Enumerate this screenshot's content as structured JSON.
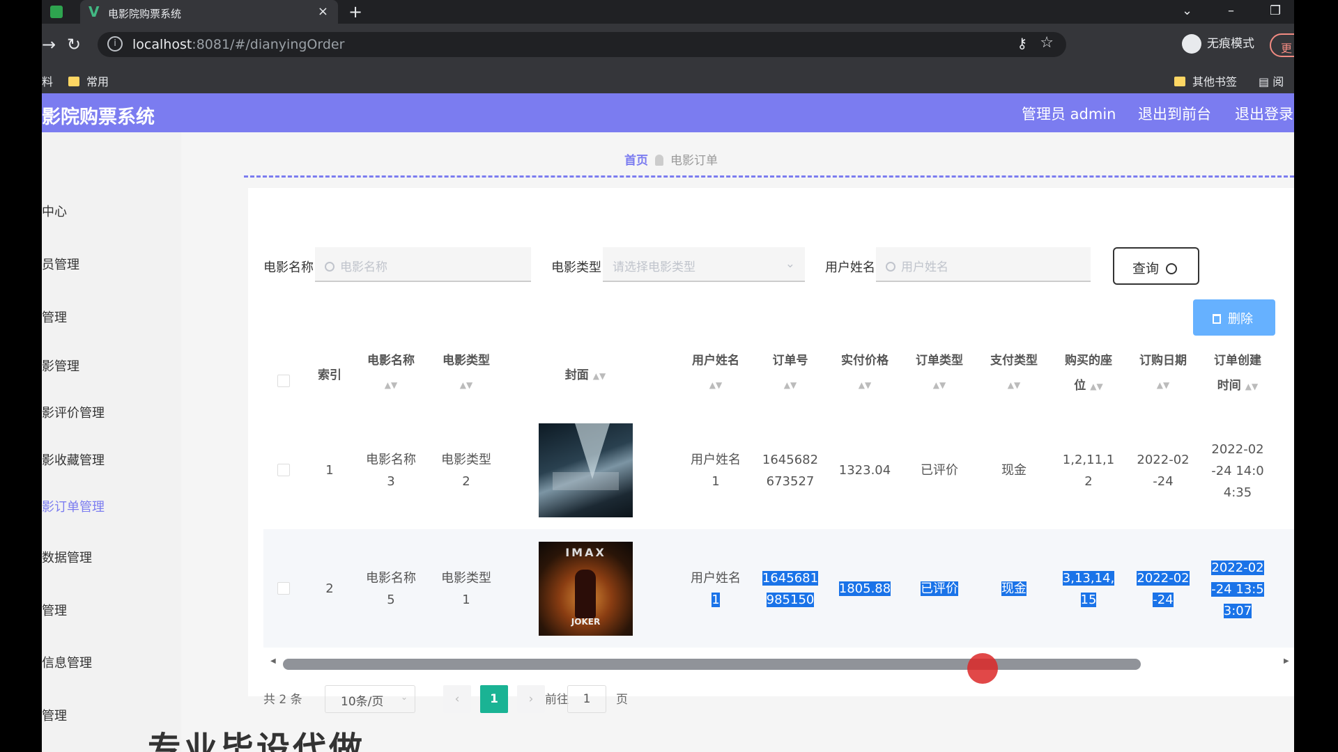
{
  "browser": {
    "tab_title": "电影院购票系统",
    "tab_close": "×",
    "new_tab": "+",
    "url_host": "localhost",
    "url_path": ":8081/#/dianyingOrder",
    "incognito_label": "无痕模式",
    "update_label": "更",
    "bookmarks": {
      "left_partial": "料",
      "folder1": "常用",
      "other": "其他书签",
      "reader": "阅"
    }
  },
  "header": {
    "title": "影院购票系统",
    "admin": "管理员 admin",
    "to_front": "退出到前台",
    "logout": "退出登录"
  },
  "sidebar": {
    "items": [
      {
        "label": "中心"
      },
      {
        "label": "员管理"
      },
      {
        "label": "管理"
      },
      {
        "label": "影管理"
      },
      {
        "label": "影评价管理"
      },
      {
        "label": "影收藏管理"
      },
      {
        "label": "影订单管理",
        "active": true
      },
      {
        "label": "数据管理"
      },
      {
        "label": "管理"
      },
      {
        "label": "信息管理"
      },
      {
        "label": "管理"
      }
    ]
  },
  "breadcrumb": {
    "home": "首页",
    "current": "电影订单"
  },
  "search": {
    "movie_name_label": "电影名称",
    "movie_name_placeholder": "电影名称",
    "movie_type_label": "电影类型",
    "movie_type_placeholder": "请选择电影类型",
    "user_name_label": "用户姓名",
    "user_name_placeholder": "用户姓名",
    "query_label": "查询"
  },
  "actions": {
    "delete_label": "删除"
  },
  "table": {
    "headers": {
      "index": "索引",
      "movie_name": "电影名称",
      "movie_type": "电影类型",
      "cover": "封面",
      "user_name": "用户姓名",
      "order_no": "订单号",
      "paid": "实付价格",
      "order_type": "订单类型",
      "pay_type": "支付类型",
      "seats_1": "购买的座",
      "seats_2": "位",
      "order_date": "订购日期",
      "create_1": "订单创建",
      "create_2": "时间"
    },
    "rows": [
      {
        "index": "1",
        "movie_name_1": "电影名称",
        "movie_name_2": "3",
        "movie_type_1": "电影类型",
        "movie_type_2": "2",
        "cover_text": "",
        "user_name_1": "用户姓名",
        "user_name_2": "1",
        "order_no_1": "1645682",
        "order_no_2": "673527",
        "paid": "1323.04",
        "order_type": "已评价",
        "pay_type": "现金",
        "seats_1": "1,2,11,1",
        "seats_2": "2",
        "order_date_1": "2022-02",
        "order_date_2": "-24",
        "create_1": "2022-02",
        "create_2": "-24 14:0",
        "create_3": "4:35"
      },
      {
        "index": "2",
        "movie_name_1": "电影名称",
        "movie_name_2": "5",
        "movie_type_1": "电影类型",
        "movie_type_2": "1",
        "cover_imax": "IMAX",
        "cover_title": "JOKER",
        "user_name_1": "用户姓名",
        "user_name_2": "1",
        "order_no_1": "1645681",
        "order_no_2": "985150",
        "paid": "1805.88",
        "order_type": "已评价",
        "pay_type": "现金",
        "seats_1": "3,13,14,",
        "seats_2": "15",
        "order_date_1": "2022-02",
        "order_date_2": "-24",
        "create_1": "2022-02",
        "create_2": "-24 13:5",
        "create_3": "3:07"
      }
    ]
  },
  "pagination": {
    "total": "共 2 条",
    "page_size": "10条/页",
    "current": "1",
    "goto_label": "前往",
    "goto_value": "1",
    "page_unit": "页"
  },
  "watermark": "专业毕设代做"
}
